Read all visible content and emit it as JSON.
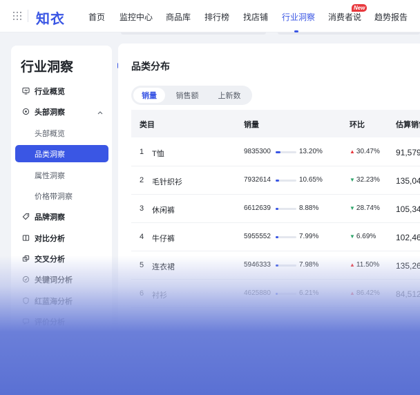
{
  "nav": {
    "logo": "知衣",
    "items": [
      "首页",
      "监控中心",
      "商品库",
      "排行榜",
      "找店铺",
      "行业洞察",
      "消费者说",
      "趋势报告"
    ],
    "active": "行业洞察",
    "badge": "New"
  },
  "sidebar": {
    "title": "行业洞察",
    "items": [
      {
        "label": "行业概览",
        "icon": "monitor-icon"
      },
      {
        "label": "头部洞察",
        "icon": "target-icon"
      },
      {
        "label": "头部概览"
      },
      {
        "label": "品类洞察"
      },
      {
        "label": "属性洞察"
      },
      {
        "label": "价格带洞察"
      },
      {
        "label": "品牌洞察",
        "icon": "tag-icon"
      },
      {
        "label": "对比分析",
        "icon": "compare-icon"
      },
      {
        "label": "交叉分析",
        "icon": "cross-icon"
      },
      {
        "label": "关键词分析",
        "icon": "keyword-icon"
      },
      {
        "label": "红蓝海分析",
        "icon": "shield-icon"
      },
      {
        "label": "评价分析",
        "icon": "comment-icon"
      }
    ]
  },
  "main": {
    "title": "品类分布",
    "tabs": [
      "销量",
      "销售额",
      "上新数"
    ],
    "active_tab": "销量",
    "columns": [
      "类目",
      "销量",
      "环比",
      "估算销售额"
    ],
    "rows": [
      {
        "index": "1",
        "name": "T恤",
        "sales": "9835300",
        "share": "13.20%",
        "share_value": 0.132,
        "yoy": "30.47%",
        "trend": "up",
        "est": "91,579"
      },
      {
        "index": "2",
        "name": "毛针织衫",
        "sales": "7932614",
        "share": "10.65%",
        "share_value": 0.1065,
        "yoy": "32.23%",
        "trend": "down",
        "est": "135,04"
      },
      {
        "index": "3",
        "name": "休闲裤",
        "sales": "6612639",
        "share": "8.88%",
        "share_value": 0.0888,
        "yoy": "28.74%",
        "trend": "down",
        "est": "105,34"
      },
      {
        "index": "4",
        "name": "牛仔裤",
        "sales": "5955552",
        "share": "7.99%",
        "share_value": 0.0799,
        "yoy": "6.69%",
        "trend": "down",
        "est": "102,46"
      },
      {
        "index": "5",
        "name": "连衣裙",
        "sales": "5946333",
        "share": "7.98%",
        "share_value": 0.0798,
        "yoy": "11.50%",
        "trend": "up",
        "est": "135,26"
      },
      {
        "index": "6",
        "name": "衬衫",
        "sales": "4625880",
        "share": "6.21%",
        "share_value": 0.0621,
        "yoy": "86.42%",
        "trend": "up",
        "est": "84,512"
      }
    ]
  },
  "colors": {
    "accent": "#3a56e4",
    "up": "#e8383d",
    "down": "#2fa56b",
    "badge": "#e8383d"
  }
}
